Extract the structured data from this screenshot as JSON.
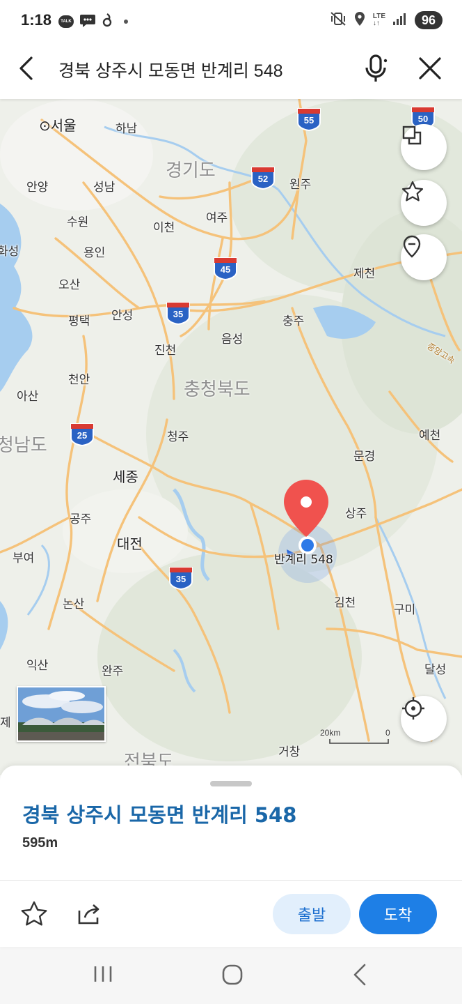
{
  "status_bar": {
    "time": "1:18",
    "talk_label": "TALK",
    "lte_label": "LTE",
    "battery": "96"
  },
  "search": {
    "query": "경북 상주시 모동면 반계리 548"
  },
  "map": {
    "regions": {
      "gyeonggi": "경기도",
      "chungbuk": "충청북도",
      "chungnam": "청남도",
      "jeonbuk": "전북도"
    },
    "cities": {
      "seoul": "서울",
      "hanam": "하남",
      "anyang": "안양",
      "seongnam": "성남",
      "suwon": "수원",
      "icheon": "이천",
      "yeoju": "여주",
      "wonju": "원주",
      "yongin": "용인",
      "hwaseong": "화성",
      "osan": "오산",
      "jecheon": "제천",
      "pyeongtaek": "평택",
      "anseong": "안성",
      "chungju": "충주",
      "eumseong": "음성",
      "jincheon": "진천",
      "cheonan": "천안",
      "asan": "아산",
      "cheongju": "청주",
      "yecheon": "예천",
      "mungyeong": "문경",
      "sejong": "세종",
      "sangju": "상주",
      "gongju": "공주",
      "daejeon": "대전",
      "buyeo": "부여",
      "nonsan": "논산",
      "gimcheon": "김천",
      "gumi": "구미",
      "iksan": "익산",
      "wanju": "완주",
      "dalseong": "달성",
      "geochang": "거창",
      "je": "제",
      "jungang_expressway": "중앙고속"
    },
    "highways": [
      "55",
      "50",
      "52",
      "45",
      "35",
      "25",
      "35"
    ],
    "marker_label": "반계리 548",
    "scale_label": "20km",
    "scale_zero": "0"
  },
  "sheet": {
    "title": "경북 상주시 모동면 반계리 548",
    "distance": "595m",
    "depart_label": "출발",
    "arrive_label": "도착"
  },
  "colors": {
    "accent": "#1e7fe6",
    "title": "#1a67a8",
    "marker": "#f0524e",
    "road": "#f5c27a",
    "water": "#a6cdef"
  }
}
